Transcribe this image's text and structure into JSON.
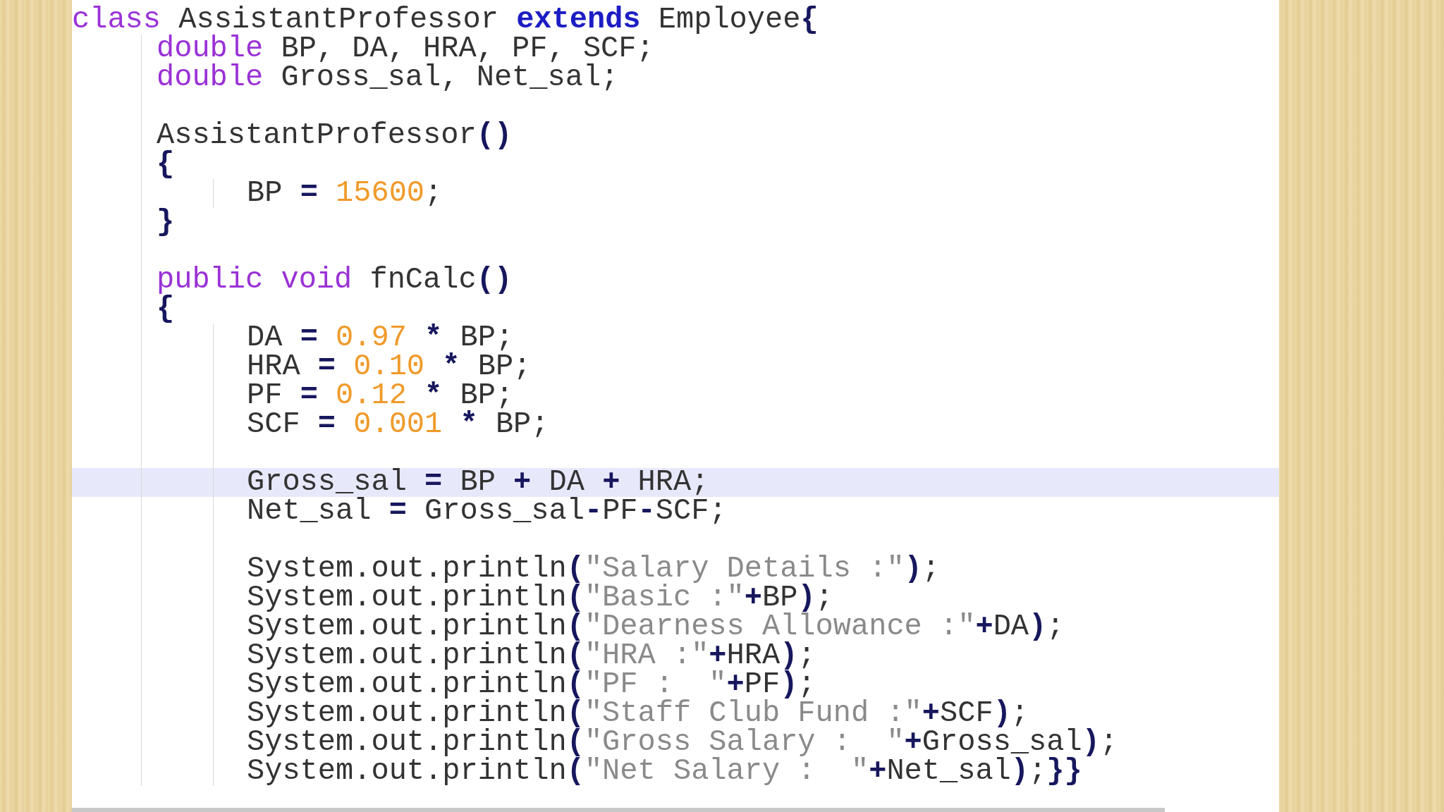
{
  "lines": [
    {
      "highlighted": false,
      "tokens": [
        {
          "kind": "kw",
          "text": "class"
        },
        {
          "kind": "id",
          "text": " AssistantProfessor "
        },
        {
          "kind": "kw2",
          "text": "extends"
        },
        {
          "kind": "id",
          "text": " Employee"
        },
        {
          "kind": "op",
          "text": "{"
        }
      ],
      "children": [
        {
          "highlighted": false,
          "tokens": [
            {
              "kind": "kw",
              "text": "double"
            },
            {
              "kind": "id",
              "text": " BP, DA, HRA, PF, SCF;"
            }
          ]
        },
        {
          "highlighted": false,
          "tokens": [
            {
              "kind": "kw",
              "text": "double"
            },
            {
              "kind": "id",
              "text": " Gross_sal, Net_sal;"
            }
          ]
        },
        {
          "highlighted": false
        },
        {
          "highlighted": false,
          "tokens": [
            {
              "kind": "id",
              "text": "AssistantProfessor"
            },
            {
              "kind": "op",
              "text": "()"
            }
          ]
        },
        {
          "highlighted": false,
          "tokens": [
            {
              "kind": "op",
              "text": "{"
            }
          ],
          "children": [
            {
              "highlighted": false,
              "tokens": [
                {
                  "kind": "id",
                  "text": "BP "
                },
                {
                  "kind": "op",
                  "text": "="
                },
                {
                  "kind": "num",
                  "text": " 15600"
                },
                {
                  "kind": "id",
                  "text": ";"
                }
              ]
            }
          ]
        },
        {
          "highlighted": false,
          "tokens": [
            {
              "kind": "op",
              "text": "}"
            }
          ]
        },
        {
          "highlighted": false
        },
        {
          "highlighted": false,
          "tokens": [
            {
              "kind": "kw",
              "text": "public void"
            },
            {
              "kind": "id",
              "text": " fnCalc"
            },
            {
              "kind": "op",
              "text": "()"
            }
          ]
        },
        {
          "highlighted": false,
          "tokens": [
            {
              "kind": "op",
              "text": "{"
            }
          ],
          "children": [
            {
              "highlighted": false,
              "tokens": [
                {
                  "kind": "id",
                  "text": "DA "
                },
                {
                  "kind": "op",
                  "text": "="
                },
                {
                  "kind": "num",
                  "text": " 0.97 "
                },
                {
                  "kind": "op",
                  "text": "*"
                },
                {
                  "kind": "id",
                  "text": " BP;"
                }
              ]
            },
            {
              "highlighted": false,
              "tokens": [
                {
                  "kind": "id",
                  "text": "HRA "
                },
                {
                  "kind": "op",
                  "text": "="
                },
                {
                  "kind": "num",
                  "text": " 0.10 "
                },
                {
                  "kind": "op",
                  "text": "*"
                },
                {
                  "kind": "id",
                  "text": " BP;"
                }
              ]
            },
            {
              "highlighted": false,
              "tokens": [
                {
                  "kind": "id",
                  "text": "PF "
                },
                {
                  "kind": "op",
                  "text": "="
                },
                {
                  "kind": "num",
                  "text": " 0.12 "
                },
                {
                  "kind": "op",
                  "text": "*"
                },
                {
                  "kind": "id",
                  "text": " BP;"
                }
              ]
            },
            {
              "highlighted": false,
              "tokens": [
                {
                  "kind": "id",
                  "text": "SCF "
                },
                {
                  "kind": "op",
                  "text": "="
                },
                {
                  "kind": "num",
                  "text": " 0.001 "
                },
                {
                  "kind": "op",
                  "text": "*"
                },
                {
                  "kind": "id",
                  "text": " BP;"
                }
              ]
            },
            {
              "highlighted": false
            },
            {
              "highlighted": true,
              "tokens": [
                {
                  "kind": "id",
                  "text": "Gross_sal "
                },
                {
                  "kind": "op",
                  "text": "="
                },
                {
                  "kind": "id",
                  "text": " BP "
                },
                {
                  "kind": "op",
                  "text": "+"
                },
                {
                  "kind": "id",
                  "text": " DA "
                },
                {
                  "kind": "op",
                  "text": "+"
                },
                {
                  "kind": "id",
                  "text": " HRA;"
                }
              ]
            },
            {
              "highlighted": false,
              "tokens": [
                {
                  "kind": "id",
                  "text": "Net_sal "
                },
                {
                  "kind": "op",
                  "text": "="
                },
                {
                  "kind": "id",
                  "text": " Gross_sal"
                },
                {
                  "kind": "op",
                  "text": "-"
                },
                {
                  "kind": "id",
                  "text": "PF"
                },
                {
                  "kind": "op",
                  "text": "-"
                },
                {
                  "kind": "id",
                  "text": "SCF;"
                }
              ]
            },
            {
              "highlighted": false
            },
            {
              "highlighted": false,
              "tokens": [
                {
                  "kind": "id",
                  "text": "System.out.println"
                },
                {
                  "kind": "op",
                  "text": "("
                },
                {
                  "kind": "str",
                  "text": "\"Salary Details :\""
                },
                {
                  "kind": "op",
                  "text": ")"
                },
                {
                  "kind": "id",
                  "text": ";"
                }
              ]
            },
            {
              "highlighted": false,
              "tokens": [
                {
                  "kind": "id",
                  "text": "System.out.println"
                },
                {
                  "kind": "op",
                  "text": "("
                },
                {
                  "kind": "str",
                  "text": "\"Basic :\""
                },
                {
                  "kind": "op",
                  "text": "+"
                },
                {
                  "kind": "id",
                  "text": "BP"
                },
                {
                  "kind": "op",
                  "text": ")"
                },
                {
                  "kind": "id",
                  "text": ";"
                }
              ]
            },
            {
              "highlighted": false,
              "tokens": [
                {
                  "kind": "id",
                  "text": "System.out.println"
                },
                {
                  "kind": "op",
                  "text": "("
                },
                {
                  "kind": "str",
                  "text": "\"Dearness Allowance :\""
                },
                {
                  "kind": "op",
                  "text": "+"
                },
                {
                  "kind": "id",
                  "text": "DA"
                },
                {
                  "kind": "op",
                  "text": ")"
                },
                {
                  "kind": "id",
                  "text": ";"
                }
              ]
            },
            {
              "highlighted": false,
              "tokens": [
                {
                  "kind": "id",
                  "text": "System.out.println"
                },
                {
                  "kind": "op",
                  "text": "("
                },
                {
                  "kind": "str",
                  "text": "\"HRA :\""
                },
                {
                  "kind": "op",
                  "text": "+"
                },
                {
                  "kind": "id",
                  "text": "HRA"
                },
                {
                  "kind": "op",
                  "text": ")"
                },
                {
                  "kind": "id",
                  "text": ";"
                }
              ]
            },
            {
              "highlighted": false,
              "tokens": [
                {
                  "kind": "id",
                  "text": "System.out.println"
                },
                {
                  "kind": "op",
                  "text": "("
                },
                {
                  "kind": "str",
                  "text": "\"PF :  \""
                },
                {
                  "kind": "op",
                  "text": "+"
                },
                {
                  "kind": "id",
                  "text": "PF"
                },
                {
                  "kind": "op",
                  "text": ")"
                },
                {
                  "kind": "id",
                  "text": ";"
                }
              ]
            },
            {
              "highlighted": false,
              "tokens": [
                {
                  "kind": "id",
                  "text": "System.out.println"
                },
                {
                  "kind": "op",
                  "text": "("
                },
                {
                  "kind": "str",
                  "text": "\"Staff Club Fund :\""
                },
                {
                  "kind": "op",
                  "text": "+"
                },
                {
                  "kind": "id",
                  "text": "SCF"
                },
                {
                  "kind": "op",
                  "text": ")"
                },
                {
                  "kind": "id",
                  "text": ";"
                }
              ]
            },
            {
              "highlighted": false,
              "tokens": [
                {
                  "kind": "id",
                  "text": "System.out.println"
                },
                {
                  "kind": "op",
                  "text": "("
                },
                {
                  "kind": "str",
                  "text": "\"Gross Salary :  \""
                },
                {
                  "kind": "op",
                  "text": "+"
                },
                {
                  "kind": "id",
                  "text": "Gross_sal"
                },
                {
                  "kind": "op",
                  "text": ")"
                },
                {
                  "kind": "id",
                  "text": ";"
                }
              ]
            },
            {
              "highlighted": false,
              "tokens": [
                {
                  "kind": "id",
                  "text": "System.out.println"
                },
                {
                  "kind": "op",
                  "text": "("
                },
                {
                  "kind": "str",
                  "text": "\"Net Salary :  \""
                },
                {
                  "kind": "op",
                  "text": "+"
                },
                {
                  "kind": "id",
                  "text": "Net_sal"
                },
                {
                  "kind": "op",
                  "text": ")"
                },
                {
                  "kind": "id",
                  "text": ";"
                },
                {
                  "kind": "op",
                  "text": "}}"
                }
              ]
            }
          ]
        }
      ]
    }
  ]
}
